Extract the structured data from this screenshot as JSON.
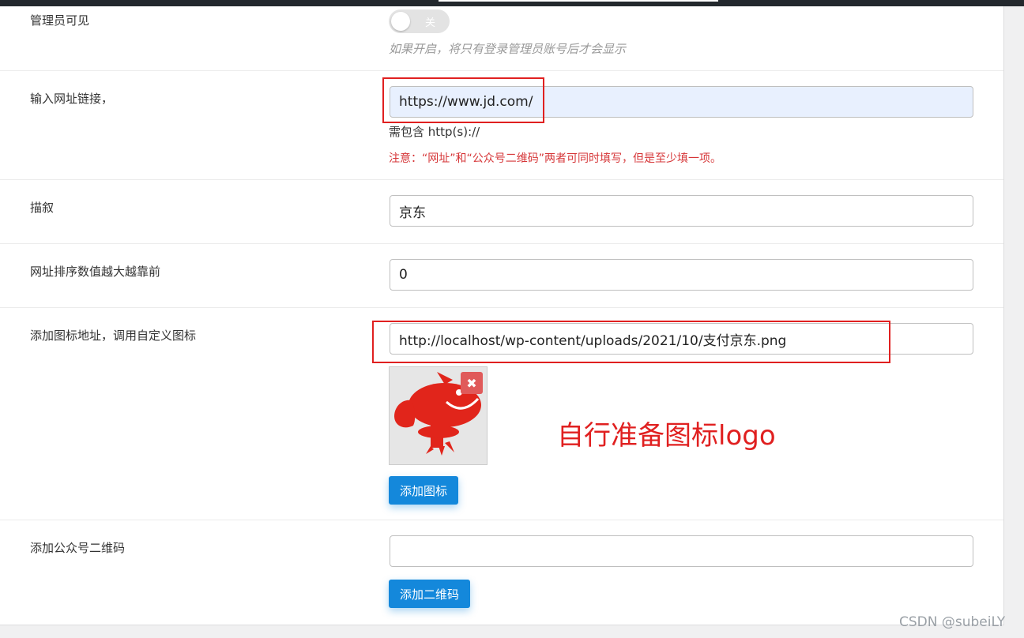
{
  "admin_visible": {
    "label": "管理员可见",
    "toggle_text": "关",
    "hint": "如果开启，将只有登录管理员账号后才会显示"
  },
  "url_link": {
    "label": "输入网址链接，",
    "value": "https://www.jd.com/",
    "note": "需包含 http(s)://",
    "warning": "注意：“网址”和“公众号二维码”两者可同时填写，但是至少填一项。"
  },
  "description": {
    "label": "描叙",
    "value": "京东"
  },
  "sort_order": {
    "label": "网址排序数值越大越靠前",
    "value": "0"
  },
  "icon_url": {
    "label": "添加图标地址，调用自定义图标",
    "value": "http://localhost/wp-content/uploads/2021/10/支付京东.png",
    "remove_symbol": "✖",
    "button_label": "添加图标",
    "annotation": "自行准备图标logo"
  },
  "qrcode": {
    "label": "添加公众号二维码",
    "value": "",
    "button_label": "添加二维码"
  },
  "watermark": "CSDN @subeiLY",
  "colors": {
    "button": "#1488db",
    "highlight_box": "#e02020",
    "warning_text": "#d63638",
    "logo_red": "#e1251b"
  }
}
